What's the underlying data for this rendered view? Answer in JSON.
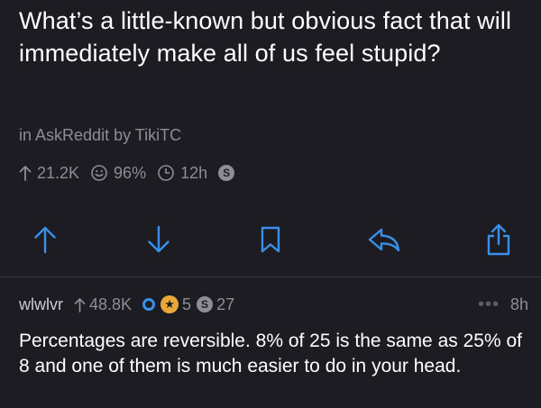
{
  "post": {
    "title": "What’s a little-known but obvious fact that will immediately make all of us feel stupid?",
    "in_label": "in",
    "subreddit": "AskReddit",
    "by_label": "by",
    "author": "TikiTC",
    "upvotes": "21.2K",
    "upvote_ratio": "96%",
    "age": "12h",
    "silver_badge": "S"
  },
  "actions": {
    "icons": [
      "upvote-arrow",
      "downvote-arrow",
      "bookmark",
      "reply",
      "share"
    ]
  },
  "comment": {
    "author": "wlwlvr",
    "score": "48.8K",
    "award_gold_count": "5",
    "award_silver_count": "27",
    "award_silver_letter": "S",
    "age": "8h",
    "more": "•••",
    "body": "Percentages are reversible.  8% of 25 is the same as 25% of 8 and one of them is much easier to do in your head."
  },
  "colors": {
    "background": "#1c1c22",
    "accent": "#3a8fe8",
    "muted": "#8d8d96",
    "gold": "#e8a83a"
  }
}
